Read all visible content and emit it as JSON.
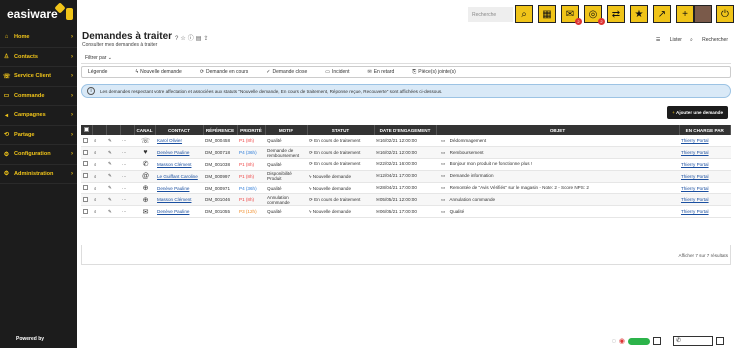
{
  "sidebar": {
    "logo": "easiware",
    "items": [
      {
        "label": "Home",
        "icon": "home-icon",
        "glyph": "⌂"
      },
      {
        "label": "Contacts",
        "icon": "contacts-icon",
        "glyph": "♙"
      },
      {
        "label": "Service Client",
        "icon": "service-icon",
        "glyph": "☏"
      },
      {
        "label": "Commande",
        "icon": "cart-icon",
        "glyph": "▭"
      },
      {
        "label": "Campagnes",
        "icon": "megaphone-icon",
        "glyph": "◂"
      },
      {
        "label": "Partage",
        "icon": "share-icon",
        "glyph": "⟲"
      },
      {
        "label": "Configuration",
        "icon": "gear-icon",
        "glyph": "⚙"
      },
      {
        "label": "Administration",
        "icon": "admin-icon",
        "glyph": "⚙"
      }
    ],
    "powered_prefix": "Powered by",
    "powered_brand": ""
  },
  "topbar": {
    "search_placeholder": "Recherche",
    "badges": {
      "mail": "2",
      "chat": "2"
    }
  },
  "page": {
    "title": "Demandes à traiter",
    "subtitle": "Consulter mes demandes à traiter",
    "filter_label": "Filtrer par",
    "list_label": "Lister",
    "search_label": "Rechercher"
  },
  "legend": {
    "title": "Légende",
    "items": [
      "Nouvelle demande",
      "Demande en cours",
      "Demande close",
      "Incident",
      "En retard",
      "Pièce(s) jointe(s)"
    ]
  },
  "info_text": "Les demandes respectant votre affectation et associées aux statuts \"Nouvelle demande, En cours de traitement, Réponse reçue, Recouverte\" sont affichées ci-dessous.",
  "add_button": "Ajouter une demande",
  "table": {
    "headers": [
      "CANAL",
      "CONTACT",
      "RÉFÉRENCE",
      "PRIORITÉ",
      "MOTIF",
      "STATUT",
      "DATE D'ENGAGEMENT",
      "OBJET",
      "EN CHARGE PAR"
    ],
    "rows": [
      {
        "canal": "☏",
        "contact": "Karol Olivier",
        "ref": "DM_000458",
        "prio": "P1 (8h)",
        "prio_class": "pr-red",
        "motif": "Qualité",
        "statut": "En cours de traitement",
        "date": "16/02/21 12:00:00",
        "objet": "Dédommagement",
        "charge": "Thierry Portal"
      },
      {
        "canal": "♥",
        "contact": "Denève Pauline",
        "ref": "DM_000718",
        "prio": "P4 (36h)",
        "prio_class": "pr-blue",
        "motif": "Demande de remboursement",
        "statut": "En cours de traitement",
        "date": "16/02/21 12:00:00",
        "objet": "Remboursement",
        "charge": "Thierry Portal"
      },
      {
        "canal": "✆",
        "contact": "Masson Clément",
        "ref": "DM_001038",
        "prio": "P1 (8h)",
        "prio_class": "pr-red",
        "motif": "Qualité",
        "statut": "En cours de traitement",
        "date": "22/02/21 16:00:00",
        "objet": "Bonjour mon produit ne fonctionne plus !",
        "charge": "Thierry Portal"
      },
      {
        "canal": "@",
        "contact": "Le Guiffant Caroline",
        "ref": "DM_000997",
        "prio": "P1 (8h)",
        "prio_class": "pr-red",
        "motif": "Disponibilité Produit",
        "statut": "Nouvelle demande",
        "date": "12/04/21 17:00:00",
        "objet": "Demande information",
        "charge": "Thierry Portal"
      },
      {
        "canal": "⊕",
        "contact": "Denève Pauline",
        "ref": "DM_000971",
        "prio": "P4 (36h)",
        "prio_class": "pr-blue",
        "motif": "Qualité",
        "statut": "Nouvelle demande",
        "date": "28/04/21 17:00:00",
        "objet": "Remontée de \"Avis Vérifiés\" sur le magasin - Note: 2 - Score NPS: 2",
        "charge": "Thierry Portal"
      },
      {
        "canal": "⊕",
        "contact": "Masson Clément",
        "ref": "DM_001046",
        "prio": "P1 (8h)",
        "prio_class": "pr-red",
        "motif": "Annulation commande",
        "statut": "En cours de traitement",
        "date": "05/05/21 12:00:00",
        "objet": "Annulation commande",
        "charge": "Thierry Portal"
      },
      {
        "canal": "✉",
        "contact": "Denève Pauline",
        "ref": "DM_001055",
        "prio": "P3 (12h)",
        "prio_class": "pr-orange",
        "motif": "Qualité",
        "statut": "Nouvelle demande",
        "date": "06/05/21 17:00:00",
        "objet": "Qualité",
        "charge": "Thierry Portal"
      }
    ]
  },
  "pagination_text": "Afficher 7 sur 7 résultats",
  "colors": {
    "accent": "#f0c419",
    "sidebar_bg": "#1c1c1c",
    "header_bg": "#333333"
  }
}
